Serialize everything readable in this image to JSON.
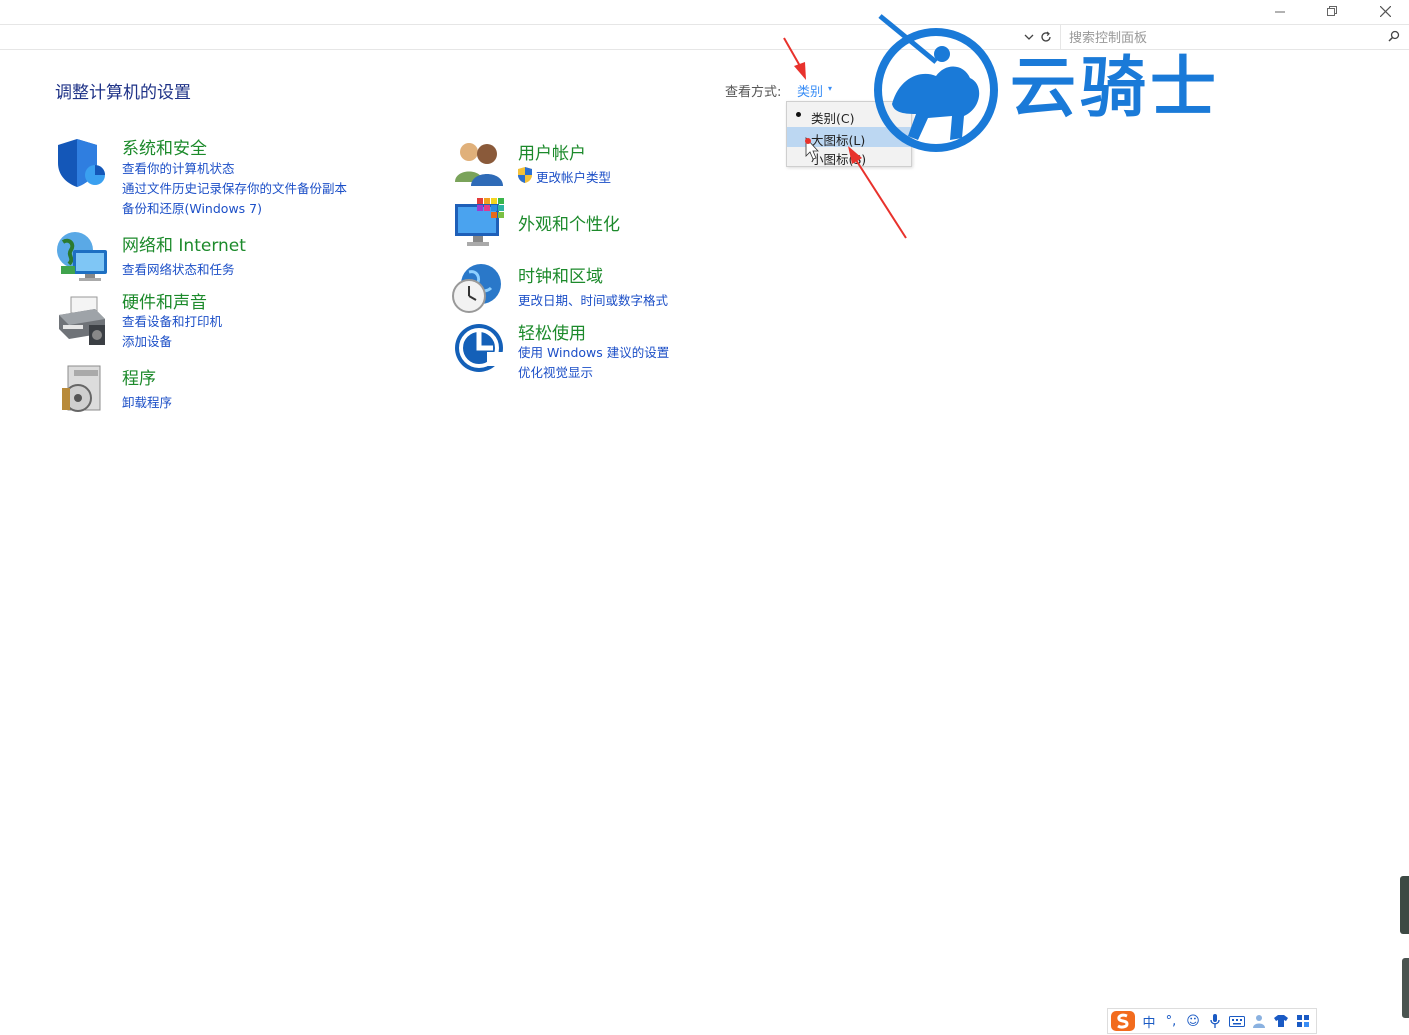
{
  "window": {
    "minimize_icon": "minimize-icon",
    "restore_icon": "restore-icon",
    "close_icon": "close-icon"
  },
  "address_bar": {
    "search_placeholder": "搜索控制面板"
  },
  "page": {
    "title": "调整计算机的设置",
    "view_by_label": "查看方式:",
    "view_by_value": "类别"
  },
  "view_menu": {
    "items": [
      {
        "label": "类别(C)",
        "selected": true
      },
      {
        "label": "大图标(L)",
        "hovered": true
      },
      {
        "label": "小图标(S)"
      }
    ]
  },
  "categories": {
    "system": {
      "title": "系统和安全",
      "links": [
        "查看你的计算机状态",
        "通过文件历史记录保存你的文件备份副本",
        "备份和还原(Windows 7)"
      ]
    },
    "network": {
      "title": "网络和 Internet",
      "links": [
        "查看网络状态和任务"
      ]
    },
    "hardware": {
      "title": "硬件和声音",
      "links": [
        "查看设备和打印机",
        "添加设备"
      ]
    },
    "programs": {
      "title": "程序",
      "links": [
        "卸载程序"
      ]
    },
    "users": {
      "title": "用户帐户",
      "links": [
        "更改帐户类型"
      ]
    },
    "appearance": {
      "title": "外观和个性化",
      "links": []
    },
    "clock": {
      "title": "时钟和区域",
      "links": [
        "更改日期、时间或数字格式"
      ]
    },
    "ease": {
      "title": "轻松使用",
      "links": [
        "使用 Windows 建议的设置",
        "优化视觉显示"
      ]
    }
  },
  "watermark": {
    "text": "云骑士"
  },
  "ime": {
    "mode": "中"
  },
  "colors": {
    "title_blue": "#1e3287",
    "category_green": "#1c8a2b",
    "link_blue": "#1c4fc7",
    "annotation_red": "#e8322c",
    "watermark_blue": "#1a7ad8"
  }
}
